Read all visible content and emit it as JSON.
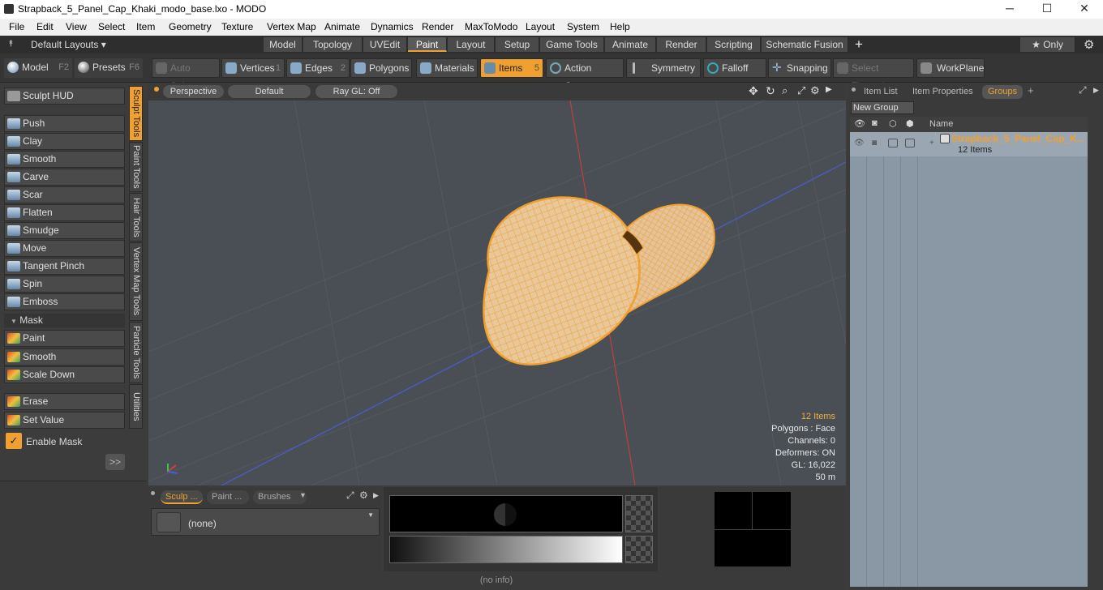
{
  "window": {
    "title": "Strapback_5_Panel_Cap_Khaki_modo_base.lxo - MODO",
    "minimize": "─",
    "maximize": "☐",
    "close": "✕"
  },
  "menu": [
    "File",
    "Edit",
    "View",
    "Select",
    "Item",
    "Geometry",
    "Texture",
    "Vertex Map",
    "Animate",
    "Dynamics",
    "Render",
    "MaxToModo",
    "Layout",
    "System",
    "Help"
  ],
  "layouts": {
    "dropdown": "Default Layouts ▾",
    "tabs": [
      "Model",
      "Topology",
      "UVEdit",
      "Paint",
      "Layout",
      "Setup",
      "Game Tools",
      "Animate",
      "Render",
      "Scripting",
      "Schematic Fusion"
    ],
    "active": "Paint",
    "plus": "+",
    "only": "★  Only",
    "gear": "⚙"
  },
  "toolbar": {
    "model": "Model",
    "model_key": "F2",
    "presets": "Presets",
    "presets_key": "F6",
    "auto_select": "Auto Select",
    "vertices": "Vertices",
    "vertices_key": "1",
    "edges": "Edges",
    "edges_key": "2",
    "polygons": "Polygons",
    "materials": "Materials",
    "items": "Items",
    "items_key": "5",
    "action_center": "Action Center",
    "symmetry": "Symmetry",
    "falloff": "Falloff",
    "snapping": "Snapping",
    "select_through": "Select Through",
    "workplane": "WorkPlane"
  },
  "left": {
    "sculpt_hud": "Sculpt HUD",
    "tools": [
      "Push",
      "Clay",
      "Smooth",
      "Carve",
      "Scar",
      "Flatten",
      "Smudge",
      "Move",
      "Tangent Pinch",
      "Spin",
      "Emboss"
    ],
    "mask_header": "Mask",
    "mask_tools": [
      "Paint",
      "Smooth",
      "Scale Down"
    ],
    "extra_tools": [
      "Erase",
      "Set Value"
    ],
    "enable_mask": "Enable Mask",
    "expand": ">>",
    "vtabs": [
      "Sculpt Tools",
      "Paint Tools",
      "Hair Tools",
      "Vertex Map Tools",
      "Particle Tools",
      "Utilities"
    ]
  },
  "viewport": {
    "view": "Perspective",
    "shading": "Default",
    "render": "Ray GL: Off",
    "info": {
      "items": "12 Items",
      "polygons": "Polygons : Face",
      "channels": "Channels: 0",
      "deformers": "Deformers: ON",
      "gl": "GL: 16,022",
      "scale": "50 m"
    },
    "colors": {
      "mesh": "#f0a030",
      "bg": "#4a4e55"
    }
  },
  "bottom": {
    "tabs": [
      "Sculp ...",
      "Paint ...",
      "Brushes"
    ],
    "brush": "(none)",
    "status": "(no info)"
  },
  "right": {
    "tabs": [
      "Item List",
      "Item Properties",
      "Groups"
    ],
    "active": "Groups",
    "new_group": "New Group",
    "col_name": "Name",
    "group_name": "Strapback_5_Panel_Cap_K...",
    "group_count": "12 Items"
  }
}
